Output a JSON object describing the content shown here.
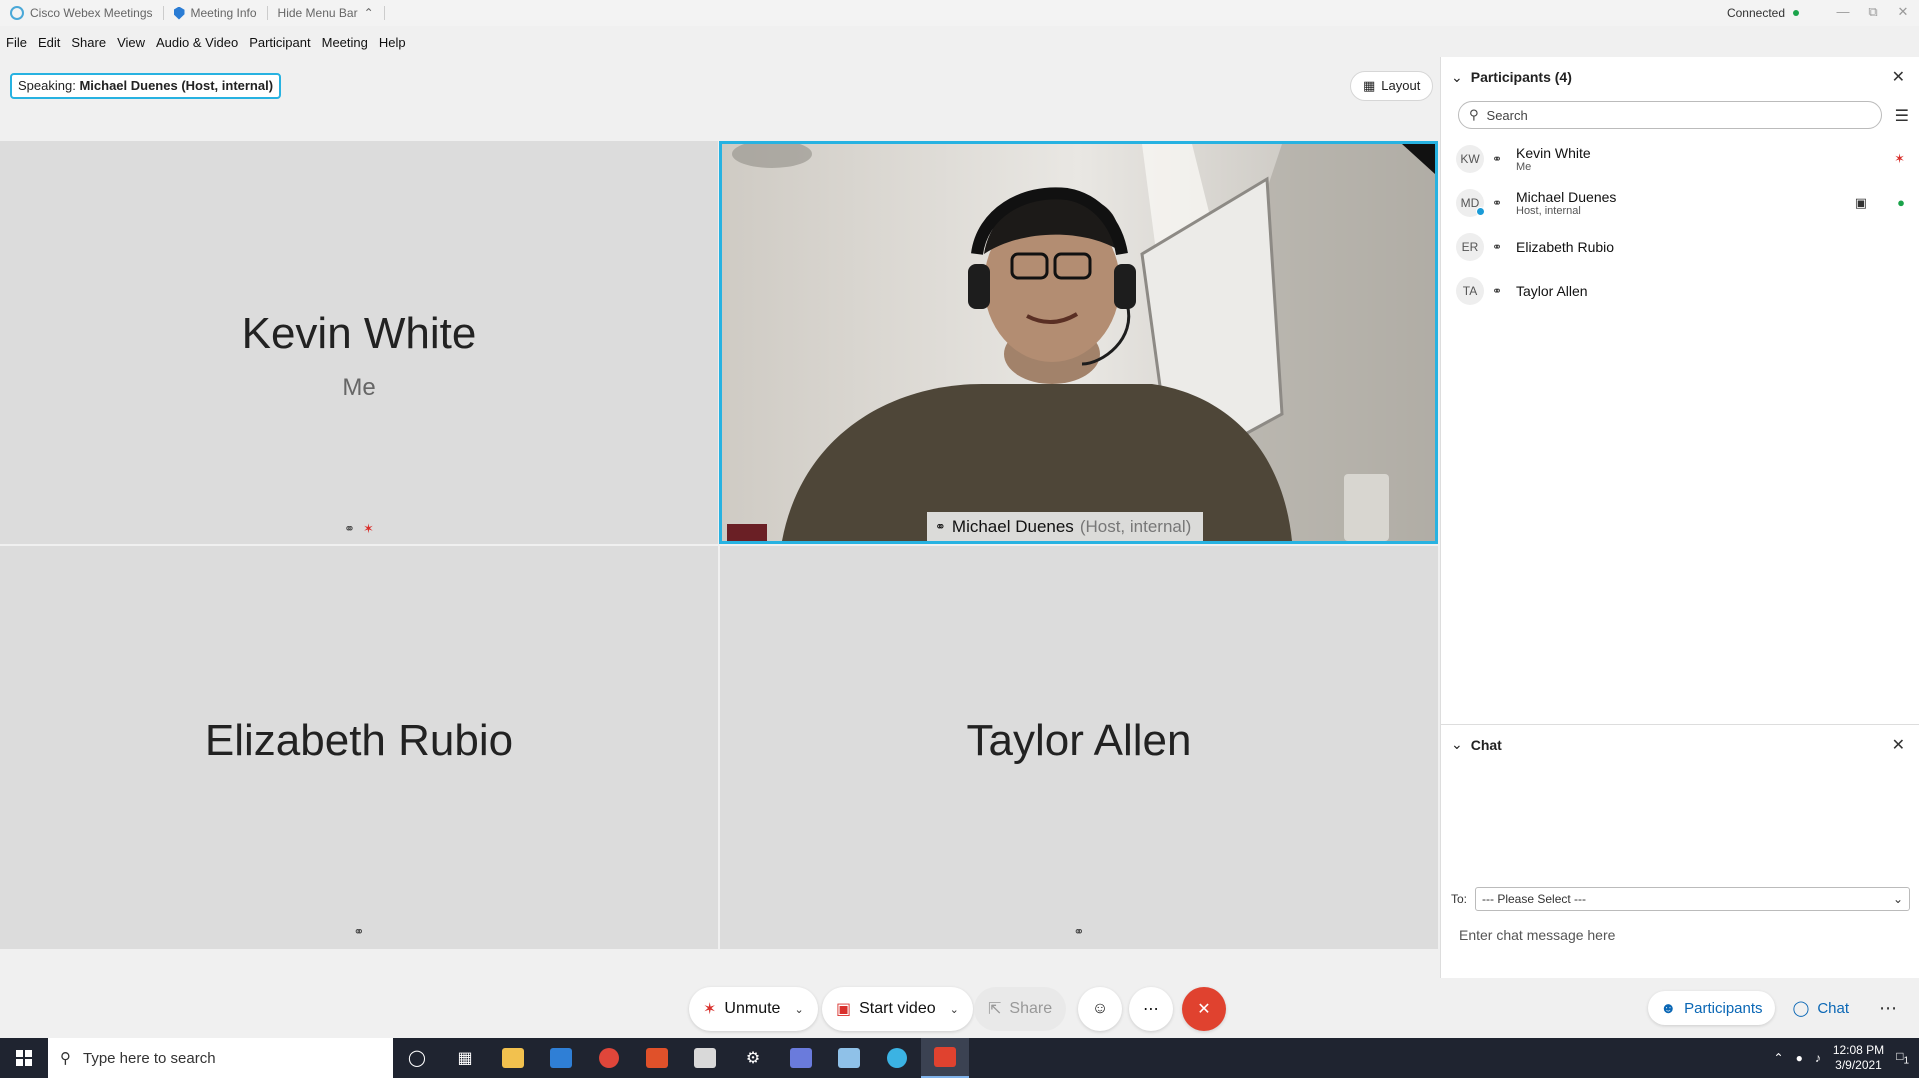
{
  "titlebar": {
    "app_name": "Cisco Webex Meetings",
    "meeting_info": "Meeting Info",
    "hide_menu": "Hide Menu Bar",
    "status": "Connected",
    "colors": {
      "status": "#1aa34a"
    }
  },
  "menu": [
    "File",
    "Edit",
    "Share",
    "View",
    "Audio & Video",
    "Participant",
    "Meeting",
    "Help"
  ],
  "speaking": {
    "label": "Speaking:",
    "name": "Michael Duenes (Host, internal)"
  },
  "layout_button": "Layout",
  "tiles": {
    "kevin": {
      "name": "Kevin White",
      "sub": "Me"
    },
    "michael": {
      "name": "Michael Duenes",
      "role": "(Host, internal)"
    },
    "elizabeth": {
      "name": "Elizabeth Rubio"
    },
    "taylor": {
      "name": "Taylor Allen"
    }
  },
  "controls": {
    "unmute": "Unmute",
    "start_video": "Start video",
    "share": "Share"
  },
  "participants_panel": {
    "title": "Participants (4)",
    "search_placeholder": "Search",
    "list": [
      {
        "initials": "KW",
        "name": "Kevin White",
        "sub": "Me"
      },
      {
        "initials": "MD",
        "name": "Michael Duenes",
        "sub": "Host, internal"
      },
      {
        "initials": "ER",
        "name": "Elizabeth Rubio",
        "sub": ""
      },
      {
        "initials": "TA",
        "name": "Taylor Allen",
        "sub": ""
      }
    ]
  },
  "chat_panel": {
    "title": "Chat",
    "to_label": "To:",
    "to_select": "--- Please Select ---",
    "input_placeholder": "Enter chat message here"
  },
  "panel_tabs": {
    "participants": "Participants",
    "chat": "Chat"
  },
  "taskbar": {
    "search_placeholder": "Type here to search",
    "time": "12:08 PM",
    "date": "3/9/2021",
    "notifications": "1"
  },
  "colors": {
    "accent": "#27b2e1",
    "end": "#e0422f",
    "muted": "#d9302c",
    "link": "#0a67b5"
  }
}
